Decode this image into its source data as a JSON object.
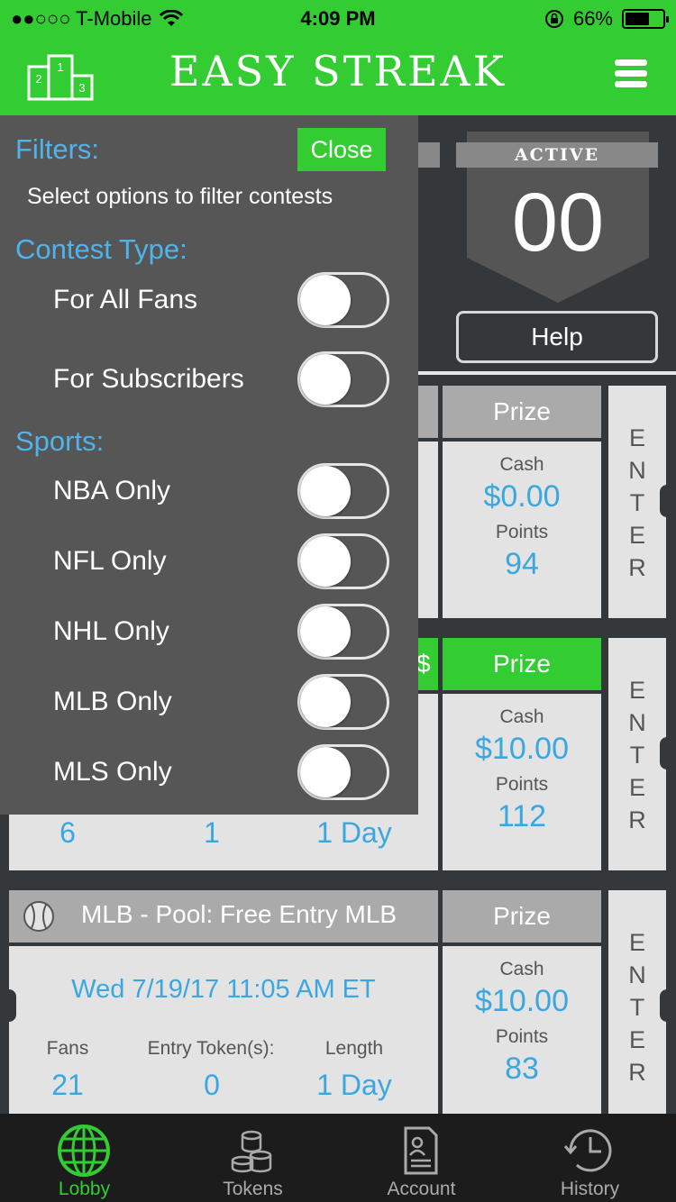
{
  "status": {
    "carrier": "●●○○○ T-Mobile",
    "time": "4:09 PM",
    "battery": "66%",
    "battery_level": 0.66
  },
  "header": {
    "title": "EASY STREAK"
  },
  "stats": {
    "active_label": "ACTIVE",
    "active_count": "00",
    "help_label": "Help"
  },
  "cards": [
    {
      "prize_label": "Prize",
      "cash_label": "Cash",
      "cash": "$0.00",
      "points_label": "Points",
      "points": "94",
      "enter": "ENTER"
    },
    {
      "head_fragment": "$",
      "prize_label": "Prize",
      "cash_label": "Cash",
      "cash": "$10.00",
      "points_label": "Points",
      "points": "112",
      "enter": "ENTER",
      "fans": "6",
      "tokens": "1",
      "length": "1 Day"
    },
    {
      "title": "MLB - Pool: Free Entry MLB",
      "date": "Wed 7/19/17 11:05 AM ET",
      "fans_label": "Fans",
      "tokens_label": "Entry Token(s):",
      "length_label": "Length",
      "fans": "21",
      "tokens": "0",
      "length": "1 Day",
      "prize_label": "Prize",
      "cash_label": "Cash",
      "cash": "$10.00",
      "points_label": "Points",
      "points": "83",
      "enter": "ENTER"
    }
  ],
  "filters": {
    "title": "Filters:",
    "close_label": "Close",
    "subtitle": "Select options to filter contests",
    "contest_type_label": "Contest Type:",
    "contest_types": [
      {
        "label": "For All Fans",
        "on": false
      },
      {
        "label": "For Subscribers",
        "on": false
      }
    ],
    "sports_label": "Sports:",
    "sports": [
      {
        "label": "NBA Only",
        "on": false
      },
      {
        "label": "NFL Only",
        "on": false
      },
      {
        "label": "NHL Only",
        "on": false
      },
      {
        "label": "MLB Only",
        "on": false
      },
      {
        "label": "MLS Only",
        "on": false
      }
    ]
  },
  "tabs": [
    {
      "label": "Lobby",
      "icon": "globe-icon",
      "active": true
    },
    {
      "label": "Tokens",
      "icon": "coins-icon",
      "active": false
    },
    {
      "label": "Account",
      "icon": "account-card-icon",
      "active": false
    },
    {
      "label": "History",
      "icon": "clock-history-icon",
      "active": false
    }
  ],
  "colors": {
    "accent": "#33cc33",
    "link_blue": "#3aa7e0",
    "panel": "#565656"
  }
}
